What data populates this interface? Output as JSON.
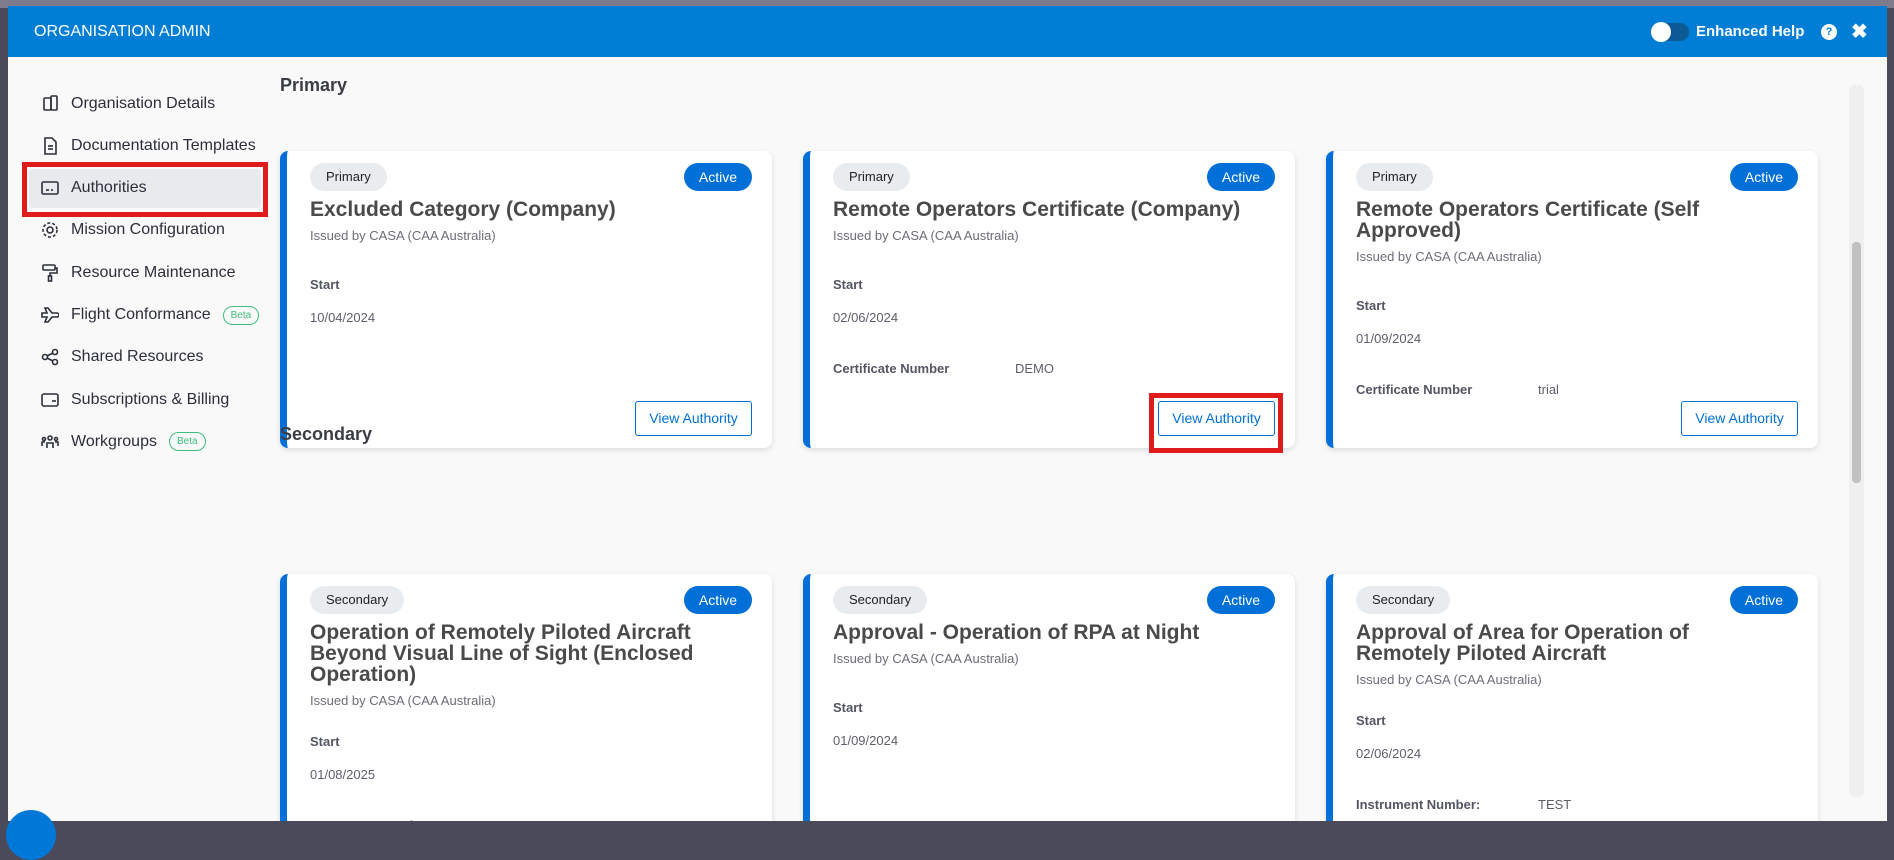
{
  "header": {
    "title": "ORGANISATION ADMIN",
    "enhanced_help": "Enhanced Help",
    "help": "?",
    "close": "✖"
  },
  "sidebar": {
    "items": [
      {
        "label": "Organisation Details",
        "icon": "building-icon"
      },
      {
        "label": "Documentation Templates",
        "icon": "document-icon"
      },
      {
        "label": "Authorities",
        "icon": "id-card-icon",
        "active": true
      },
      {
        "label": "Mission Configuration",
        "icon": "gear-icon"
      },
      {
        "label": "Resource Maintenance",
        "icon": "paint-roller-icon"
      },
      {
        "label": "Flight Conformance",
        "icon": "plane-icon",
        "badge": "Beta"
      },
      {
        "label": "Shared Resources",
        "icon": "share-icon"
      },
      {
        "label": "Subscriptions & Billing",
        "icon": "wallet-icon"
      },
      {
        "label": "Workgroups",
        "icon": "group-icon",
        "badge": "Beta"
      }
    ]
  },
  "sections": [
    {
      "title": "Primary",
      "cards": [
        {
          "type": "Primary",
          "status": "Active",
          "title": "Excluded Category (Company)",
          "issued": "Issued by CASA (CAA Australia)",
          "start_label": "Start",
          "start": "10/04/2024",
          "button": "View Authority"
        },
        {
          "type": "Primary",
          "status": "Active",
          "title": "Remote Operators Certificate (Company)",
          "issued": "Issued by CASA (CAA Australia)",
          "start_label": "Start",
          "start": "02/06/2024",
          "field_label": "Certificate Number",
          "field_value": "DEMO",
          "button": "View Authority"
        },
        {
          "type": "Primary",
          "status": "Active",
          "title": "Remote Operators Certificate (Self Approved)",
          "issued": "Issued by CASA (CAA Australia)",
          "start_label": "Start",
          "start": "01/09/2024",
          "field_label": "Certificate Number",
          "field_value": "trial",
          "button": "View Authority"
        }
      ]
    },
    {
      "title": "Secondary",
      "cards": [
        {
          "type": "Secondary",
          "status": "Active",
          "title": "Operation of Remotely Piloted Aircraft Beyond Visual Line of Sight (Enclosed Operation)",
          "issued": "Issued by CASA (CAA Australia)",
          "start_label": "Start",
          "start": "01/08/2025",
          "field_label": "Instrument Number"
        },
        {
          "type": "Secondary",
          "status": "Active",
          "title": "Approval - Operation of RPA at Night",
          "issued": "Issued by CASA (CAA Australia)",
          "start_label": "Start",
          "start": "01/09/2024"
        },
        {
          "type": "Secondary",
          "status": "Active",
          "title": "Approval of Area for Operation of Remotely Piloted Aircraft",
          "issued": "Issued by CASA (CAA Australia)",
          "start_label": "Start",
          "start": "02/06/2024",
          "field_label": "Instrument Number:",
          "field_value": "TEST"
        }
      ]
    }
  ]
}
